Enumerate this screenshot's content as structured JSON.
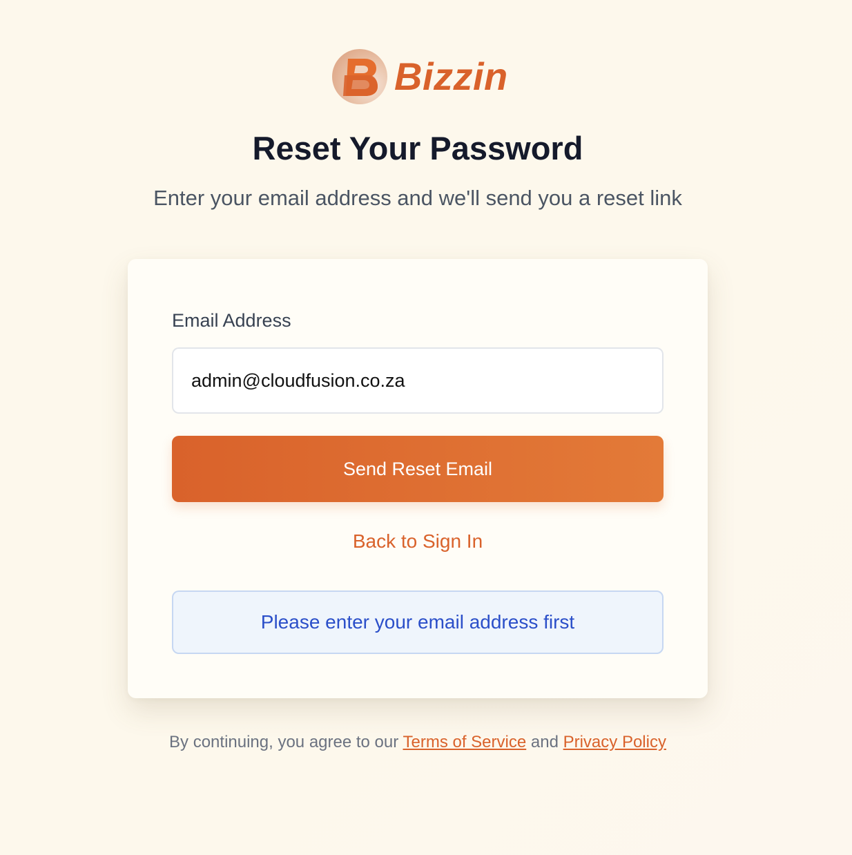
{
  "brand": {
    "name": "Bizzin",
    "logo_icon": "bizzin-b-logo-icon",
    "color": "#d9622b"
  },
  "page": {
    "title": "Reset Your Password",
    "subtitle": "Enter your email address and we'll send you a reset link"
  },
  "form": {
    "email_label": "Email Address",
    "email_value": "admin@cloudfusion.co.za",
    "submit_label": "Send Reset Email",
    "back_label": "Back to Sign In"
  },
  "notice": {
    "message": "Please enter your email address first",
    "text_color": "#2b4fc9",
    "background": "#eff5fc"
  },
  "footer": {
    "prefix": "By continuing, you agree to our ",
    "terms_label": "Terms of Service",
    "joiner": " and ",
    "privacy_label": "Privacy Policy"
  }
}
